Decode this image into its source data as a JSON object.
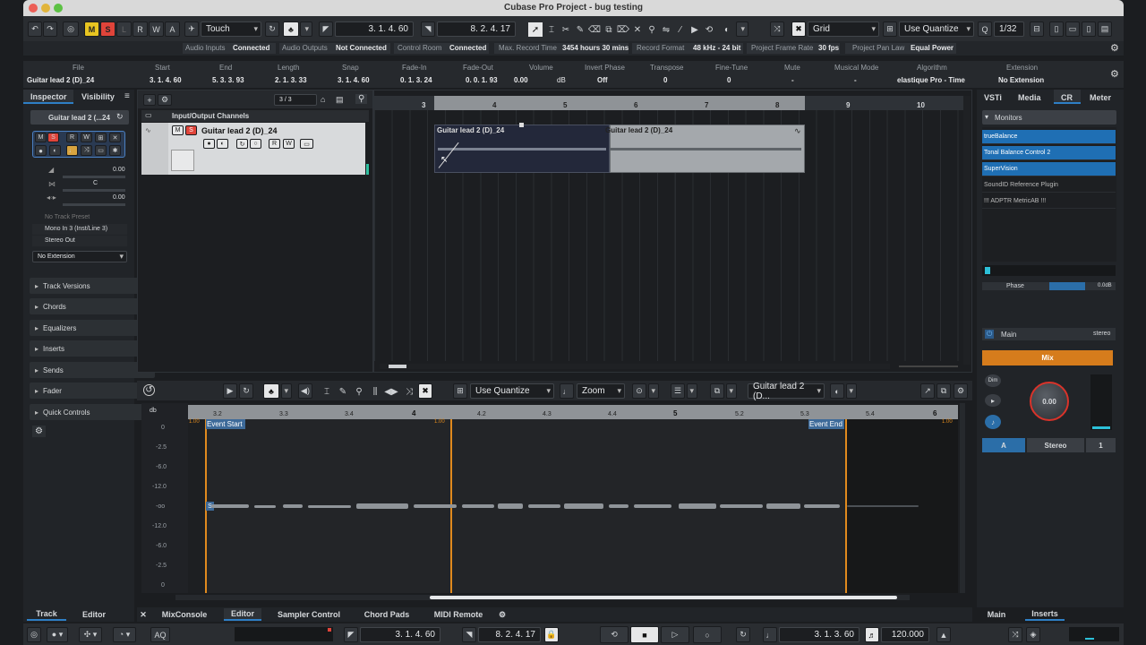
{
  "window": {
    "title": "Cubase Pro Project - bug testing"
  },
  "toolbar": {
    "mode": "Touch",
    "pos1": "3. 1. 4. 60",
    "pos2": "8. 2. 4. 17",
    "grid": "Grid",
    "quantize": "Use Quantize",
    "quant_value": "1/32",
    "msrlw": [
      "M",
      "S",
      "L",
      "R",
      "W",
      "A"
    ]
  },
  "status_bar": {
    "items": [
      {
        "label": "Audio Inputs",
        "value": "Connected"
      },
      {
        "label": "Audio Outputs",
        "value": "Not Connected"
      },
      {
        "label": "Control Room",
        "value": "Connected"
      },
      {
        "label": "Max. Record Time",
        "value": "3454 hours 30 mins"
      },
      {
        "label": "Record Format",
        "value": "48 kHz - 24 bit"
      },
      {
        "label": "Project Frame Rate",
        "value": "30 fps"
      },
      {
        "label": "Project Pan Law",
        "value": "Equal Power"
      }
    ]
  },
  "infoline": {
    "headers": [
      "File",
      "Start",
      "End",
      "Length",
      "Snap",
      "Fade-In",
      "Fade-Out",
      "Volume",
      "Invert Phase",
      "Transpose",
      "Fine-Tune",
      "Mute",
      "Musical Mode",
      "Algorithm",
      "Extension"
    ],
    "values": [
      "Guitar lead 2 (D)_24",
      "3. 1. 4. 60",
      "5. 3. 3. 93",
      "2. 1. 3. 33",
      "3. 1. 4. 60",
      "0. 1. 3. 24",
      "0. 0. 1. 93",
      "0.00",
      "Off",
      "0",
      "0",
      "-",
      "-",
      "elastique Pro - Time",
      "No Extension"
    ],
    "volume_unit": "dB"
  },
  "inspector": {
    "tabs": [
      "Inspector",
      "Visibility"
    ],
    "track_name": "Guitar lead 2 (...24",
    "vol": "0.00",
    "pan": "C",
    "pan_value": "0.00",
    "preset": "No Track Preset",
    "input": "Mono In 3 (Inst/Line 3)",
    "output": "Stereo Out",
    "extension": "No Extension",
    "sections": [
      "Track Versions",
      "Chords",
      "Equalizers",
      "Inserts",
      "Sends",
      "Fader",
      "Quick Controls"
    ]
  },
  "project": {
    "counter": "3 / 3",
    "folder": "Input/Output Channels",
    "track_name": "Guitar lead 2 (D)_24",
    "ruler": [
      "3",
      "4",
      "5",
      "6",
      "7",
      "8",
      "9",
      "10"
    ],
    "events": [
      "Guitar lead 2 (D)_24",
      "Guitar lead 2 (D)_24"
    ]
  },
  "right_zone": {
    "tabs": [
      "VSTi",
      "Media",
      "CR",
      "Meter"
    ],
    "monitors": "Monitors",
    "plugins": [
      "trueBalance",
      "Tonal Balance Control 2",
      "SuperVision",
      "SoundID Reference Plugin",
      "!!! ADPTR MetricAB !!!"
    ],
    "phase": "Phase",
    "phase_db": "0.0dB",
    "main": "Main",
    "stereo": "stereo",
    "mix": "Mix",
    "dim": "Dim",
    "knob_value": "0.00",
    "out_a": "A",
    "out_stereo": "Stereo",
    "out_num": "1",
    "bottom_tabs": [
      "Main",
      "Inserts"
    ]
  },
  "editor": {
    "quantize": "Use Quantize",
    "zoom": "Zoom",
    "track": "Guitar lead 2 (D...",
    "db_label": "db",
    "db_scale": [
      "0",
      "-2.5",
      "-6.0",
      "-12.0",
      "-oo",
      "-12.0",
      "-6.0",
      "-2.5",
      "0"
    ],
    "ruler": [
      "3.2",
      "3.3",
      "3.4",
      "4",
      "4.2",
      "4.3",
      "4.4",
      "5",
      "5.2",
      "5.3",
      "5.4",
      "6"
    ],
    "event_start": "Event Start",
    "event_end": "Event End",
    "gain": "1.00",
    "s_marker": "S"
  },
  "bottom_tabs": {
    "left": [
      "Track",
      "Editor"
    ],
    "center": [
      "MixConsole",
      "Editor",
      "Sampler Control",
      "Chord Pads",
      "MIDI Remote"
    ]
  },
  "transport": {
    "aq": "AQ",
    "left": "3. 1. 4. 60",
    "right": "8. 2. 4. 17",
    "position": "3. 1. 3. 60",
    "tempo": "120.000"
  },
  "colors": {
    "accent": "#2e7fc6",
    "orange": "#e08a1e",
    "mute": "#e8c521",
    "solo": "#e0443a"
  }
}
